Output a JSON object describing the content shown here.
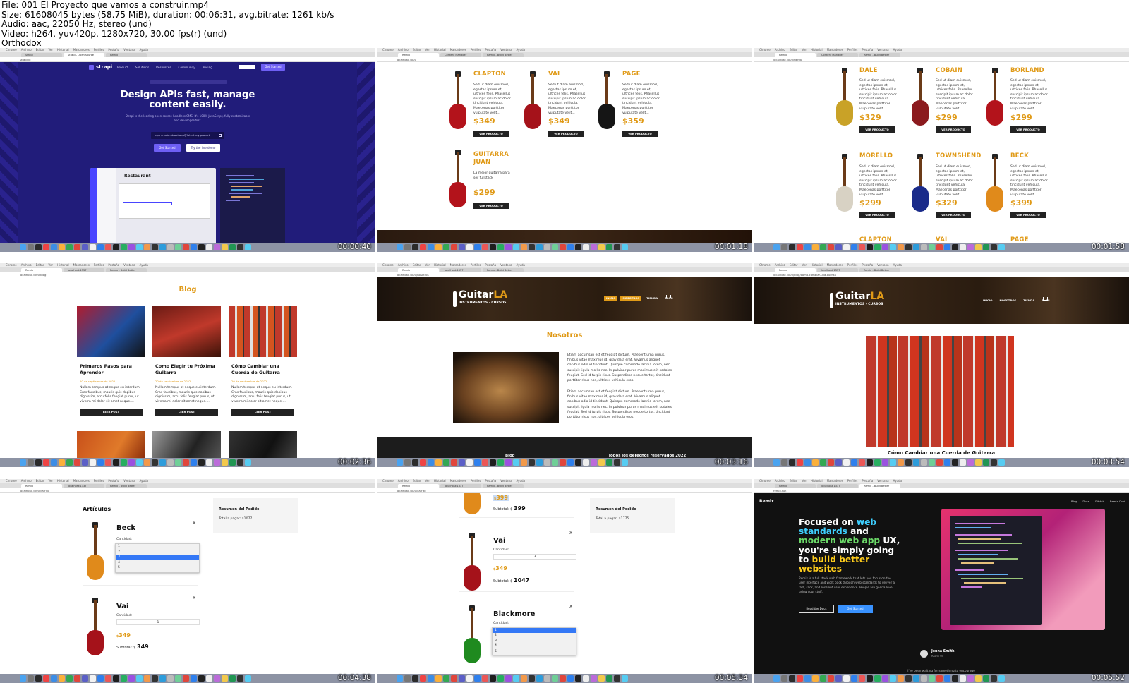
{
  "file_header": {
    "line1": "File: 001 El Proyecto que vamos a construir.mp4",
    "line2": "Size: 61608045 bytes (58.75 MiB), duration: 00:06:31, avg.bitrate: 1261 kb/s",
    "line3": "Audio: aac, 22050 Hz, stereo (und)",
    "line4": "Video: h264, yuv420p, 1280x720, 30.00 fps(r) (und)",
    "line5": "Orthodox"
  },
  "timestamps": [
    "00:00:40",
    "00:01:18",
    "00:01:58",
    "00:02:36",
    "00:03:16",
    "00:03:54",
    "00:04:38",
    "00:05:34",
    "00:05:52"
  ],
  "colors": {
    "accent": "#e09a17",
    "strapi_bg": "#211c7a",
    "strapi_btn": "#6e5ff4",
    "dock": "#8d93a4",
    "dark": "#222222",
    "remix_bg": "#111111",
    "remix_blue": "#3992ff"
  },
  "strapi": {
    "logo": "strapi",
    "nav": [
      "Product",
      "Solutions",
      "Resources",
      "Community",
      "Pricing"
    ],
    "cta": "Get Started",
    "headline": "Design APIs fast, manage content easily.",
    "sub": "Strapi is the leading open-source headless CMS. It's 100% JavaScript, fully customizable and developer-first.",
    "command": "npx create-strapi-app@latest my-project",
    "btn1": "Get Started",
    "btn2": "Try the live demo",
    "card_title": "Restaurant"
  },
  "tile2": {
    "products": [
      {
        "name": "CLAPTON",
        "price": "$349"
      },
      {
        "name": "VAI",
        "price": "$349"
      },
      {
        "name": "PAGE",
        "price": "$359"
      },
      {
        "name": "GUITARRA JUAN",
        "desc": "La mejor guitarra para ser fullstack",
        "price": "$299"
      }
    ],
    "desc": "Sed ut diam euismod, egestas ipsum et, ultrices felis. Phasellus suscipit ipsum ac dolor tincidunt vehicula. Maecenas porttitor vulputate velit...",
    "button": "VER PRODUCTO"
  },
  "tile3": {
    "products": [
      {
        "name": "DALE",
        "price": "$329"
      },
      {
        "name": "COBAIN",
        "price": "$299"
      },
      {
        "name": "BORLAND",
        "price": "$299"
      },
      {
        "name": "MORELLO",
        "price": "$299"
      },
      {
        "name": "TOWNSHEND",
        "price": "$329"
      },
      {
        "name": "BECK",
        "price": "$399"
      }
    ],
    "next_row": [
      "CLAPTON",
      "VAI",
      "PAGE"
    ],
    "desc": "Sed ut diam euismod, egestas ipsum et, ultrices felis. Phasellus suscipit ipsum ac dolor tincidunt vehicula. Maecenas porttitor vulputate velit...",
    "button": "VER PRODUCTO"
  },
  "blog": {
    "title": "Blog",
    "posts": [
      {
        "title": "Primeros Pasos para Aprender",
        "date": "20 de septiembre de 2022"
      },
      {
        "title": "Como Elegir tu Próxima Guitarra",
        "date": "20 de septiembre de 2022"
      },
      {
        "title": "Cómo Cambiar una Cuerda de Guitarra",
        "date": "20 de septiembre de 2022"
      }
    ],
    "excerpt": "Nullam tempus at neque eu interdum. Cras faucibus, mauris quis dapibus dignissim, arcu felis feugiat purus, ut viverra mi dolor sit amet neque....",
    "button": "LEER POST"
  },
  "nosotros": {
    "logo_main": "Guitar",
    "logo_accent": "LA",
    "logo_sub": "INSTRUMENTOS - CURSOS",
    "nav": [
      "INICIO",
      "NOSOTROS",
      "TIENDA",
      "BLOG"
    ],
    "title": "Nosotros",
    "p1": "Etiam accumsan est et feugiat dictum. Praesent urna purus, finibus vitae maximus id, gravida a erat. Vivamus aliquet dapibus odio id tincidunt. Quisque commodo lacinia lorem, nec suscipit ligula mollis nec. In pulvinar purus maximus elit sodales feugiat. Sed id turpis risus. Suspendisse neque tortor, tincidunt porttitor risus non, ultrices vehicula eros.",
    "p2": "Etiam accumsan est et feugiat dictum. Praesent urna purus, finibus vitae maximus id, gravida a erat. Vivamus aliquet dapibus odio id tincidunt. Quisque commodo lacinia lorem, nec suscipit ligula mollis nec. In pulvinar purus maximus elit sodales feugiat. Sed id turpis risus. Suspendisse neque tortor, tincidunt porttitor risus non, ultrices vehicula eros.",
    "footer_link": "Blog",
    "footer_copy": "Todos los derechos reservados 2022"
  },
  "post": {
    "logo_main": "Guitar",
    "logo_accent": "LA",
    "logo_sub": "INSTRUMENTOS - CURSOS",
    "nav": [
      "INICIO",
      "NOSOTROS",
      "TIENDA",
      "BLOG"
    ],
    "title": "Cómo Cambiar una Cuerda de Guitarra"
  },
  "cart1": {
    "heading": "Artículos",
    "items": [
      {
        "name": "Beck",
        "qty_label": "Cantidad:",
        "options": [
          "1",
          "2",
          "3",
          "4",
          "5"
        ],
        "selected": "3"
      },
      {
        "name": "Vai",
        "qty_label": "Cantidad:",
        "qty": "1",
        "price": "349",
        "subtotal_label": "Subtotal: $",
        "subtotal": "349"
      }
    ],
    "close": "x",
    "summary_title": "Resumen del Pedido",
    "total_label": "Total a pagar: $1077"
  },
  "cart2": {
    "top_price": "399",
    "top_subtotal_label": "Subtotal: $",
    "top_subtotal": "399",
    "items": [
      {
        "name": "Vai",
        "qty_label": "Cantidad:",
        "qty": "3",
        "price": "349",
        "subtotal_label": "Subtotal: $",
        "subtotal": "1047"
      },
      {
        "name": "Blackmore",
        "qty_label": "Cantidad:",
        "options": [
          "1",
          "2",
          "3",
          "4",
          "5"
        ],
        "selected": "1"
      }
    ],
    "close": "x",
    "summary_title": "Resumen del Pedido",
    "total_label": "Total a pagar: $1775"
  },
  "remix": {
    "logo": "Remix",
    "nav": [
      "Blog",
      "Docs",
      "GitHub",
      "Remix Conf"
    ],
    "h_part1": "Focused on ",
    "h_web": "web standards",
    "h_part2": " and ",
    "h_modern": "modern web app",
    "h_part3": " UX, you're simply going to ",
    "h_build": "build better websites",
    "para": "Remix is a full stack web framework that lets you focus on the user interface and work back through web standards to deliver a fast, slick, and resilient user experience. People are gonna love using your stuff.",
    "btn1": "Read the Docs",
    "btn2": "Get Started",
    "testimonial_name": "Jenna Smith",
    "testimonial_role": "RADIX UI",
    "testimonial_quote": "I've been waiting for something to encourage"
  }
}
